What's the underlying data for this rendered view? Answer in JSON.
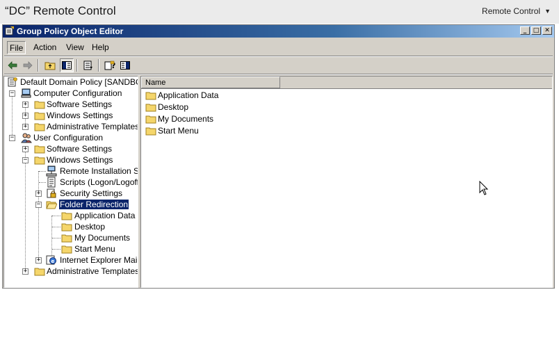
{
  "remote": {
    "title": "“DC” Remote Control",
    "menu_label": "Remote Control",
    "menu_caret": "▼"
  },
  "window": {
    "title": "Group Policy Object Editor",
    "controls": {
      "minimize": "_",
      "maximize": "□",
      "close": "✕"
    }
  },
  "menu": {
    "file": "File",
    "action": "Action",
    "view": "View",
    "help": "Help"
  },
  "tree": {
    "root": "Default Domain Policy [SANDBOX-V",
    "computer_config": "Computer Configuration",
    "cc_software": "Software Settings",
    "cc_windows": "Windows Settings",
    "cc_admin": "Administrative Templates",
    "user_config": "User Configuration",
    "uc_software": "Software Settings",
    "uc_windows": "Windows Settings",
    "remote_install": "Remote Installation Se",
    "scripts": "Scripts (Logon/Logoff)",
    "security": "Security Settings",
    "folder_redirection": "Folder Redirection",
    "fr_appdata": "Application Data",
    "fr_desktop": "Desktop",
    "fr_mydocs": "My Documents",
    "fr_startmenu": "Start Menu",
    "ie_maint": "Internet Explorer Maint",
    "uc_admin": "Administrative Templates"
  },
  "list": {
    "column_name": "Name",
    "items": [
      "Application Data",
      "Desktop",
      "My Documents",
      "Start Menu"
    ]
  },
  "colors": {
    "titlebar_start": "#0a246a",
    "titlebar_end": "#a6caf0",
    "folder_fill": "#f5d66b",
    "folder_edge": "#a08020",
    "selection": "#0a246a"
  }
}
